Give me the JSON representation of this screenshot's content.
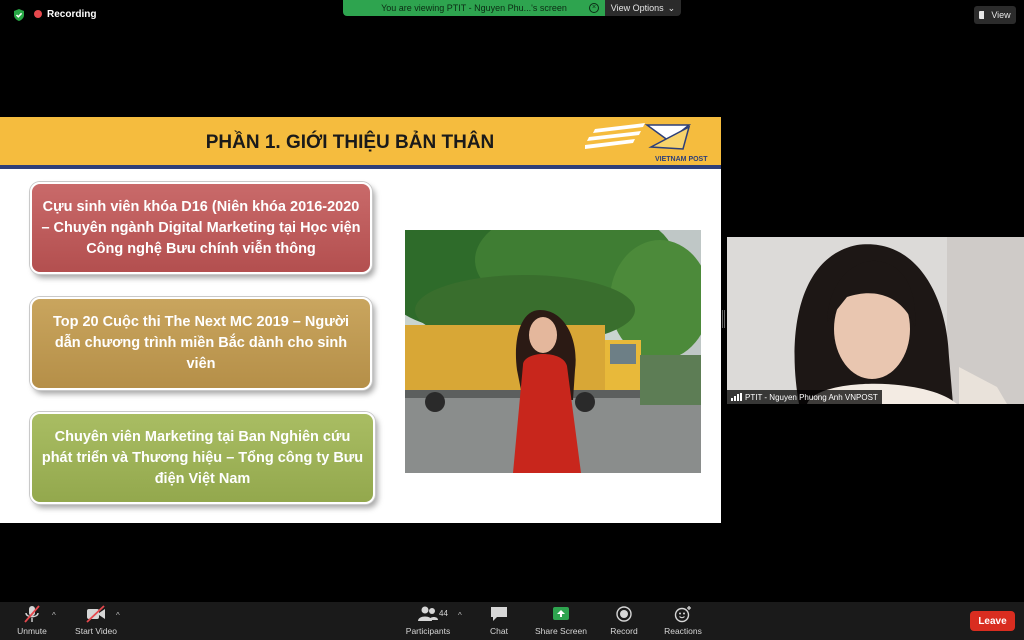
{
  "top_bar": {
    "recording_label": "Recording",
    "viewing_banner": "You are viewing PTIT - Nguyen Phu...'s screen",
    "view_options_label": "View Options",
    "view_label": "View"
  },
  "slide": {
    "title": "PHẦN 1. GIỚI THIỆU BẢN THÂN",
    "logo_text": "VIETNAM POST",
    "boxes": [
      "Cựu sinh viên khóa D16 (Niên khóa 2016-2020 – Chuyên ngành Digital Marketing tại Học viện Công nghệ Bưu chính viễn thông",
      "Top 20 Cuộc thi The Next MC 2019 – Người dẫn chương trình miền Bắc dành cho sinh viên",
      "Chuyên viên Marketing tại Ban Nghiên cứu phát triển và Thương hiệu – Tổng công ty Bưu điện Việt Nam"
    ]
  },
  "webcam": {
    "participant_name": "PTIT - Nguyen Phuong Anh VNPOST"
  },
  "toolbar": {
    "unmute_label": "Unmute",
    "start_video_label": "Start Video",
    "participants_label": "Participants",
    "participants_count": "44",
    "chat_label": "Chat",
    "share_screen_label": "Share Screen",
    "record_label": "Record",
    "reactions_label": "Reactions",
    "leave_label": "Leave"
  },
  "colors": {
    "slide_header": "#f5bc3e",
    "slide_header_stripe": "#2d3f79",
    "box_red": "#bd5959",
    "box_gold": "#bf9a52",
    "box_green": "#9db357",
    "share_green": "#2ea44f",
    "leave_red": "#d92d20"
  },
  "icons": [
    "shield-check-icon",
    "record-dot-icon",
    "view-icon",
    "mic-muted-icon",
    "video-off-icon",
    "participants-icon",
    "chat-icon",
    "share-screen-icon",
    "record-icon",
    "reactions-icon",
    "signal-bars-icon"
  ]
}
